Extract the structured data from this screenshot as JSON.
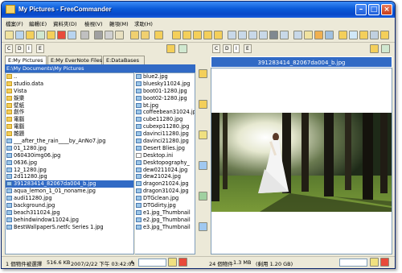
{
  "window": {
    "title": "My Pictures - FreeCommander"
  },
  "menu": [
    "檔案(F)",
    "編輯(E)",
    "資料夾(D)",
    "檢視(V)",
    "雜項(M)",
    "求助(H)"
  ],
  "drives": {
    "left": [
      "C",
      "D",
      "I",
      "E"
    ],
    "right": [
      "C",
      "D",
      "I",
      "E"
    ]
  },
  "left_tabs": [
    "E:My Pictures",
    "E:My EverNote Files",
    "E:DataBases"
  ],
  "left_path": "E:\\My Documents\\My Pictures",
  "right_path": "391283414_82067da004_b.jpg",
  "col1": [
    {
      "name": "..",
      "type": "folder"
    },
    {
      "name": "studio.data",
      "type": "folder"
    },
    {
      "name": "Vista",
      "type": "folder"
    },
    {
      "name": "娛樂",
      "type": "folder"
    },
    {
      "name": "壁紙",
      "type": "folder"
    },
    {
      "name": "創作",
      "type": "folder"
    },
    {
      "name": "電腦",
      "type": "folder"
    },
    {
      "name": "電腦",
      "type": "folder"
    },
    {
      "name": "雜題",
      "type": "folder"
    },
    {
      "name": "___after_the_rain____by_AnNo7.jpg",
      "type": "img"
    },
    {
      "name": "01_1280.jpg",
      "type": "img"
    },
    {
      "name": "060430img06.jpg",
      "type": "img"
    },
    {
      "name": "0636.jpg",
      "type": "img"
    },
    {
      "name": "12_1280.jpg",
      "type": "img"
    },
    {
      "name": "2d11280.jpg",
      "type": "img"
    },
    {
      "name": "391283414_82067da004_b.jpg",
      "type": "img",
      "selected": true
    },
    {
      "name": "aqua_lemon_1_01_noname.jpg",
      "type": "img"
    },
    {
      "name": "audi11280.jpg",
      "type": "img"
    },
    {
      "name": "background.jpg",
      "type": "img"
    },
    {
      "name": "beach311024.jpg",
      "type": "img"
    },
    {
      "name": "behindwindow11024.jpg",
      "type": "img"
    },
    {
      "name": "BestWallpaperS.netfc Series 1.jpg",
      "type": "img"
    }
  ],
  "col2": [
    {
      "name": "blue2.jpg",
      "type": "img"
    },
    {
      "name": "bluesky11024.jpg",
      "type": "img"
    },
    {
      "name": "boot01-1280.jpg",
      "type": "img"
    },
    {
      "name": "boot02-1280.jpg",
      "type": "img"
    },
    {
      "name": "bt.jpg",
      "type": "img"
    },
    {
      "name": "coffeebean31024.jpg",
      "type": "img"
    },
    {
      "name": "cube11280.jpg",
      "type": "img"
    },
    {
      "name": "cubexp11280.jpg",
      "type": "img"
    },
    {
      "name": "davinci11280.jpg",
      "type": "img"
    },
    {
      "name": "davinci21280.jpg",
      "type": "img"
    },
    {
      "name": "Desert Blies.jpg",
      "type": "img"
    },
    {
      "name": "Desktop.ini",
      "type": "file"
    },
    {
      "name": "Desktopography_",
      "type": "img"
    },
    {
      "name": "dew0211024.jpg",
      "type": "img"
    },
    {
      "name": "dew21024.jpg",
      "type": "img"
    },
    {
      "name": "dragon21024.jpg",
      "type": "img"
    },
    {
      "name": "dragon31024.jpg",
      "type": "img"
    },
    {
      "name": "DTGclean.jpg",
      "type": "img"
    },
    {
      "name": "DTGdirty.jpg",
      "type": "img"
    },
    {
      "name": "e1.jpg_Thumbnail",
      "type": "img"
    },
    {
      "name": "e2.jpg_Thumbnail",
      "type": "img"
    },
    {
      "name": "e3.jpg_Thumbnail",
      "type": "img"
    }
  ],
  "status_left": {
    "count": "1 個物件被選擇",
    "size": "516.6 KB",
    "date": "2007/2/22 下午 03:42:03",
    "attr": "A"
  },
  "status_right": {
    "count": "24 個物件",
    "size": "1.3 MB",
    "free": "(剩用 1.20 GB)"
  },
  "colors": {
    "title": "#0a5ad8",
    "selection": "#316ac5",
    "face": "#ece9d8"
  }
}
